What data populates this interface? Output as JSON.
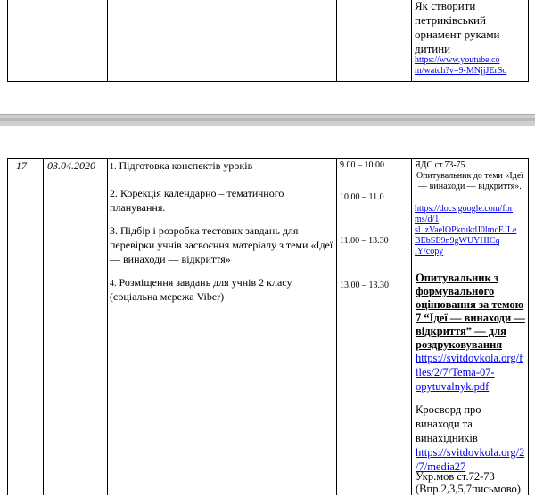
{
  "top_row": {
    "resource_title": "Як створити петриківський орнамент руками дитини",
    "resource_link": "https://www.youtube.com/watch?v=9-MNjjJErSo",
    "resource_link_line1": "https://www.youtube.co",
    "resource_link_line2": "m/watch?v=9-MNjjJErSo"
  },
  "row": {
    "number": "17",
    "date": "03.04.2020",
    "tasks": [
      {
        "num": "1.",
        "text": "Підготовка конспектів уроків"
      },
      {
        "num": "2.",
        "text": "Корекція календарно – тематичного планування."
      },
      {
        "num": "3.",
        "text": "Підбір і розробка тестових завдань для перевірки учнів засвоєння матеріалу з теми «Ідеї — винаходи — відкриття»"
      },
      {
        "num": "4.",
        "text": "Розміщення завдань для учнів 2 класу (соціальна мережа Viber)"
      }
    ],
    "times": [
      "9.00 – 10.00",
      "10.00 – 11.0",
      "11.00 – 13.30",
      "13.00 – 13.30"
    ],
    "resources": {
      "yds": "ЯДС ст.73-75",
      "questionnaire": "Опитувальник до теми «Ідеї — винаходи — відкриття».",
      "google_form_link": "https://docs.google.com/forms/d/1sl_zVaelOPkrukdJ0lmcEJLeBEbSE9n9gWUYHICqlY/copy",
      "google_lines": [
        "https://docs.google.com/for",
        "ms/d/1",
        "sl_zVaelOPkrukdJ0lmcEJLe",
        "BEbSE9n9gWUYHICq",
        "lY/copy"
      ],
      "formative_title": "Опитувальник з формувального оцінювання за темою 7 “Ідеї — винаходи — відкриття” — для роздруковування",
      "formative_lines": [
        "Опитувальник з",
        "формувального",
        "оцінювання за темою",
        "7 “Ідеї — винаходи —",
        "відкриття” — для",
        "роздруковування"
      ],
      "formative_link": "https://svitdovkola.org/files/2/7/Tema-07-opytuvalnyk.pdf",
      "formative_link_lines": [
        "https://svitdovkola.org/f",
        "iles/2/7/Tema-07-",
        "opytuvalnyk.pdf"
      ],
      "crossword_title": "Кросворд про винаходи та винахідників",
      "crossword_lines": [
        "Кросворд про",
        "винаходи та",
        "винахідників"
      ],
      "crossword_link": "https://svitdovkola.org/2/7/media27",
      "crossword_link_lines": [
        "https://svitdovkola.org/2",
        "/7/media27"
      ],
      "ukr": "Укр.мов ст.72-73",
      "exercises": "(Впр.2,3,5,7письмово)"
    }
  }
}
